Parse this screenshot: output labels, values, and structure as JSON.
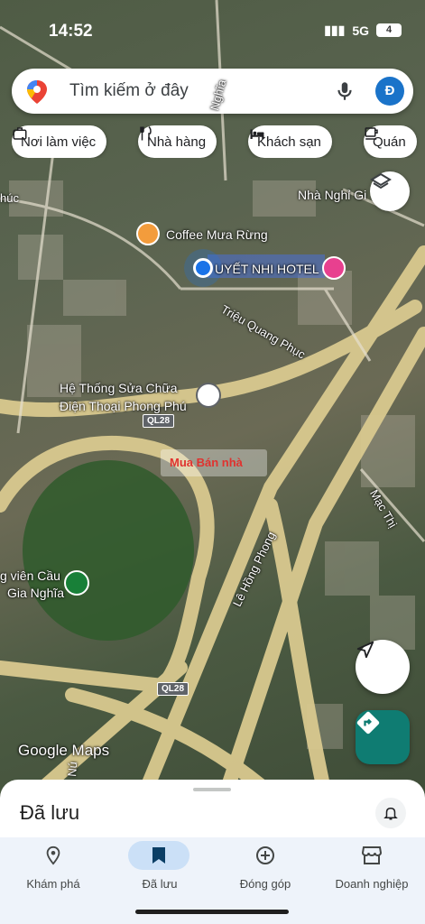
{
  "status_bar": {
    "time": "14:52",
    "network": "5G",
    "battery": "4"
  },
  "search": {
    "placeholder": "Tìm kiếm ở đây",
    "avatar_letter": "Đ"
  },
  "chips": [
    {
      "label": "Nơi làm việc",
      "icon": "briefcase-icon"
    },
    {
      "label": "Nhà hàng",
      "icon": "fork-knife-icon"
    },
    {
      "label": "Khách sạn",
      "icon": "bed-icon"
    },
    {
      "label": "Quán",
      "icon": "coffee-icon"
    }
  ],
  "map": {
    "places": {
      "nha_nghi": "Nhà Nghỉ Gi",
      "coffee": "Coffee Mưa Rừng",
      "hotel": "UYẾT NHI HOTEL",
      "repair_line1": "Hệ Thống Sửa Chữa",
      "repair_line2": "Điện Thoại Phong Phú",
      "park_line1": "g viên Cầu",
      "park_line2": "Gia Nghĩa"
    },
    "roads": {
      "trieu_quang_phuc": "Triệu Quang Phục",
      "le_hong_phong": "Lê Hồng Phong",
      "mac_thi": "Mạc Thị",
      "nghia": "Nghĩa",
      "huc": "húc",
      "nu": "Nú"
    },
    "shields": {
      "top": "QL28",
      "bottom": "QL28"
    },
    "watermark": "Mua Bán nhà",
    "attribution": "Google Maps"
  },
  "sheet": {
    "title": "Đã lưu"
  },
  "bottom_nav": [
    {
      "label": "Khám phá",
      "icon": "explore-pin-icon",
      "active": false
    },
    {
      "label": "Đã lưu",
      "icon": "bookmark-icon",
      "active": true
    },
    {
      "label": "Đóng góp",
      "icon": "add-circle-icon",
      "active": false
    },
    {
      "label": "Doanh nghiệp",
      "icon": "storefront-icon",
      "active": false
    }
  ],
  "colors": {
    "accent": "#1a73e8",
    "directions": "#0f7c72",
    "nav_active": "#cbe0f7",
    "road": "#d9c98f"
  }
}
